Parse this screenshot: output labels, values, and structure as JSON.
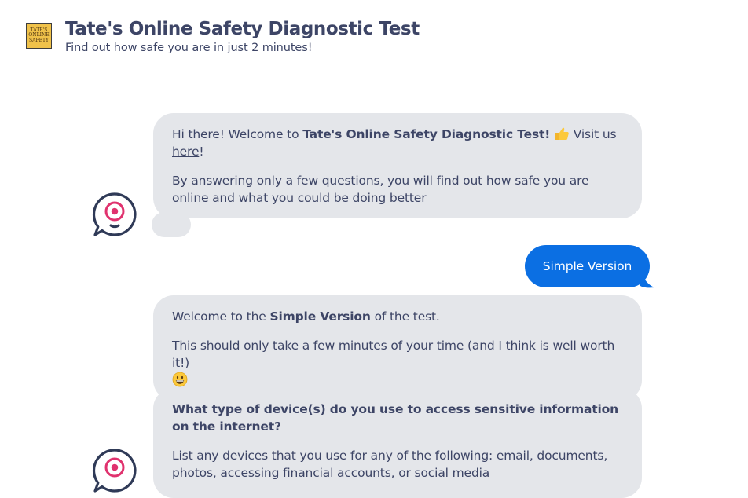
{
  "header": {
    "logo_lines": [
      "TATE'S",
      "ONLINE",
      "SAFETY"
    ],
    "title": "Tate's Online Safety Diagnostic Test",
    "subtitle": "Find out how safe you are in just 2 minutes!"
  },
  "messages": {
    "welcome": {
      "intro_before": "Hi there! Welcome to ",
      "intro_bold": "Tate's Online Safety Diagnostic Test!",
      "intro_emoji": "thumbs-up-icon",
      "visit_text": " Visit us ",
      "visit_link": "here",
      "visit_after": "!",
      "body": "By answering only a few questions, you will find out how safe you are online and what you could be doing better"
    },
    "user_reply": "Simple Version",
    "simple": {
      "before": "Welcome to the ",
      "bold": "Simple Version",
      "after": " of the test.",
      "body": "This should only take a few minutes of your time (and I think is well worth it!)",
      "emoji": "grinning-face-icon"
    },
    "question": {
      "title": "What type of device(s) do you use to access sensitive information on the internet?",
      "body": "List any devices that you use for any of the following: email, documents, photos, accessing financial accounts, or social media"
    }
  },
  "colors": {
    "bot_bubble": "#e4e6ea",
    "user_bubble": "#0b6fe3",
    "text": "#3d4566",
    "accent": "#e0326e",
    "avatar_outline": "#2f3a57"
  }
}
